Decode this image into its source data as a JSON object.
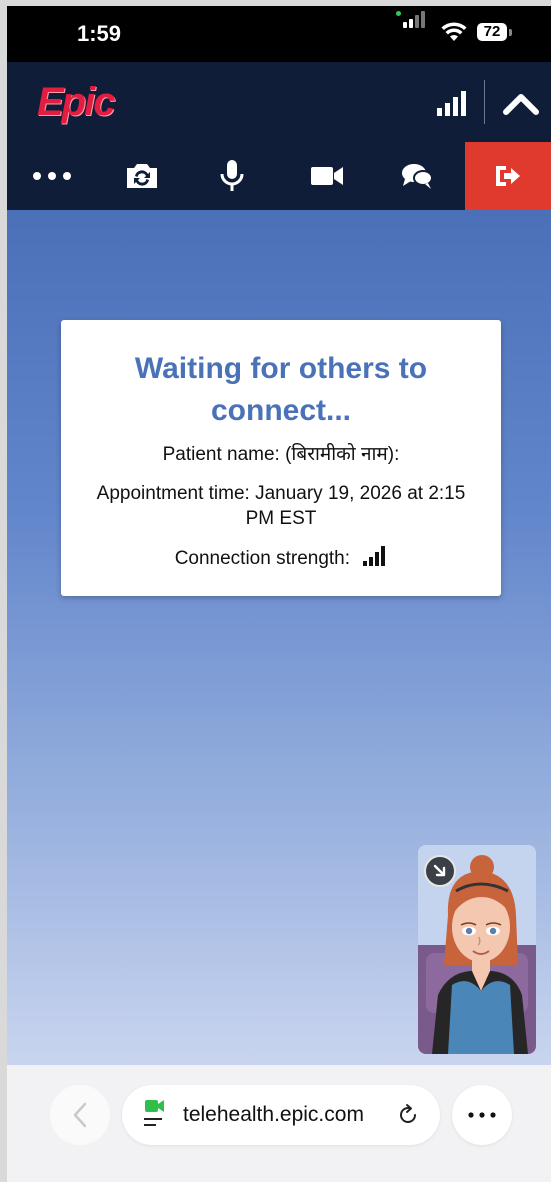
{
  "status_bar": {
    "time": "1:59",
    "battery": "72"
  },
  "header": {
    "logo_text": "Epic",
    "logo_color": "#e21d3f",
    "icons": [
      "signal-strength-icon",
      "chevron-up-icon"
    ]
  },
  "toolbar": {
    "buttons": [
      "more-options",
      "switch-camera",
      "microphone",
      "camera",
      "chat",
      "leave-visit"
    ],
    "exit_color": "#e03a2f"
  },
  "waiting_card": {
    "title": "Waiting for others to connect...",
    "patient_label": "Patient name: (बिरामीको नाम):",
    "appointment_label": "Appointment time: January 19, 2026 at 2:15 PM EST",
    "connection_label": "Connection strength:",
    "title_color": "#4a72b8"
  },
  "browser": {
    "url": "telehealth.epic.com"
  },
  "colors": {
    "header_bg": "#0f1d39",
    "stage_top": "#4c70b8",
    "stage_bottom": "#c9d5ef"
  }
}
